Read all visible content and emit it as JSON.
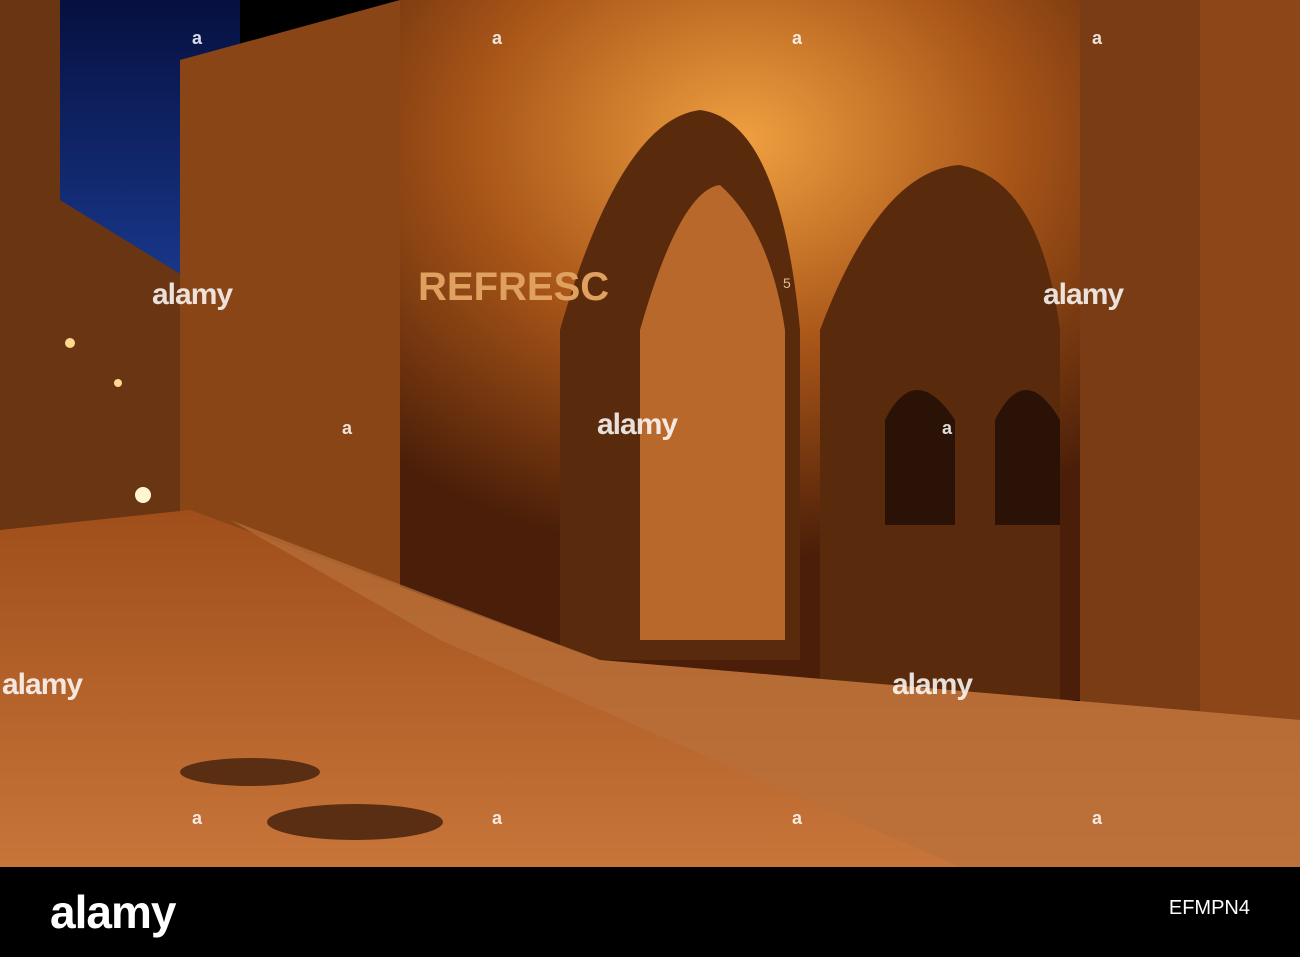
{
  "photo": {
    "subject": "Night street with gothic stone arches",
    "sign_text": "REFRESC",
    "door_number": "5",
    "colors": {
      "sky": "#0a1a5a",
      "stone": "#b0601c",
      "light": "#ffb040",
      "street": "#c0682a"
    }
  },
  "watermark": {
    "text": "alamy",
    "mark": "a"
  },
  "footer": {
    "logo": "alamy",
    "image_id": "EFMPN4"
  }
}
